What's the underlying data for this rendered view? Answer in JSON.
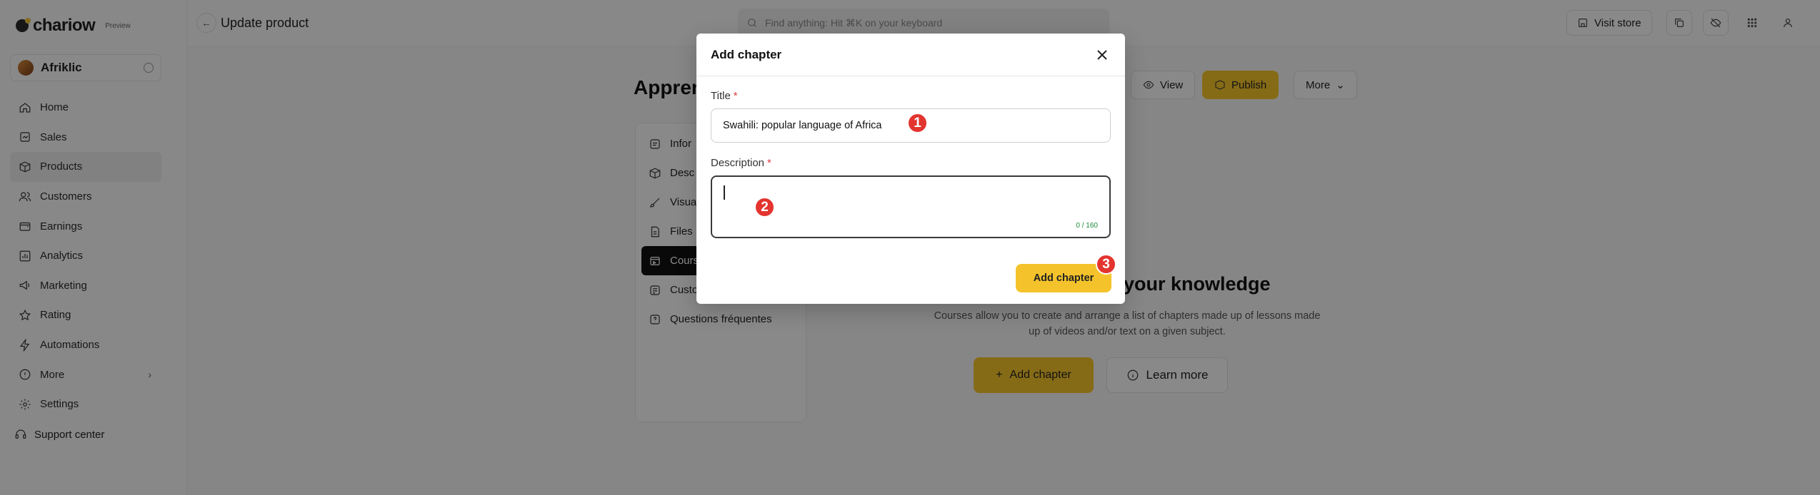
{
  "app": {
    "logo_text": "chariow",
    "logo_badge": "Preview"
  },
  "store": {
    "name": "Afriklic"
  },
  "sidebar": {
    "items": [
      {
        "label": "Home",
        "icon": "home-icon"
      },
      {
        "label": "Sales",
        "icon": "sales-icon"
      },
      {
        "label": "Products",
        "icon": "box-icon",
        "active": true
      },
      {
        "label": "Customers",
        "icon": "users-icon"
      },
      {
        "label": "Earnings",
        "icon": "wallet-icon"
      },
      {
        "label": "Analytics",
        "icon": "chart-icon"
      },
      {
        "label": "Marketing",
        "icon": "megaphone-icon"
      },
      {
        "label": "Rating",
        "icon": "star-icon"
      },
      {
        "label": "Automations",
        "icon": "bolt-icon"
      },
      {
        "label": "More",
        "icon": "more-icon",
        "chevron": "›"
      },
      {
        "label": "Settings",
        "icon": "gear-icon"
      }
    ],
    "support": "Support center"
  },
  "topbar": {
    "back": "←",
    "title": "Update product",
    "search_placeholder": "Find anything: Hit ⌘K on your keyboard",
    "visit_store": "Visit store"
  },
  "product": {
    "title": "Apprene",
    "view": "View",
    "publish": "Publish",
    "more": "More"
  },
  "subnav": {
    "items": [
      {
        "label": "Infor",
        "icon": "info-icon"
      },
      {
        "label": "Desc",
        "icon": "cube-icon"
      },
      {
        "label": "Visua",
        "icon": "brush-icon"
      },
      {
        "label": "Files",
        "icon": "file-icon"
      },
      {
        "label": "Cours",
        "icon": "course-icon",
        "active": true
      },
      {
        "label": "Custo",
        "icon": "form-icon"
      },
      {
        "label": "Questions fréquentes",
        "icon": "faq-icon"
      }
    ]
  },
  "empty_state": {
    "title": "your knowledge",
    "description": "Courses allow you to create and arrange a list of chapters made up of lessons made up of videos and/or text on a given subject.",
    "add_label": "Add chapter",
    "learn_label": "Learn more"
  },
  "modal": {
    "title": "Add chapter",
    "title_label": "Title",
    "title_value": "Swahili: popular language of Africa",
    "description_label": "Description",
    "description_value": "",
    "counter": "0 / 160",
    "required_mark": "*",
    "submit": "Add chapter"
  },
  "markers": [
    "1",
    "2",
    "3"
  ],
  "colors": {
    "accent": "#f4c32b",
    "marker": "#e3342f",
    "counter": "#1a8a3a"
  }
}
